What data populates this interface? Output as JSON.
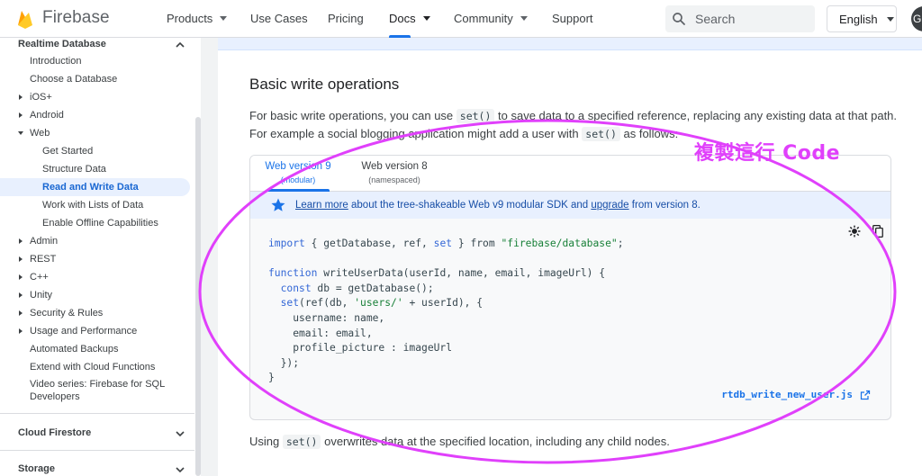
{
  "header": {
    "brand": "Firebase",
    "nav": [
      {
        "label": "Products",
        "dropdown": true
      },
      {
        "label": "Use Cases",
        "dropdown": false
      },
      {
        "label": "Pricing",
        "dropdown": false
      },
      {
        "label": "Docs",
        "dropdown": true,
        "active": true
      },
      {
        "label": "Community",
        "dropdown": true
      },
      {
        "label": "Support",
        "dropdown": false
      }
    ],
    "search_placeholder": "Search",
    "language": "English",
    "avatar_initial": "G"
  },
  "sidebar": {
    "section_title": "Realtime Database",
    "items": [
      {
        "label": "Introduction"
      },
      {
        "label": "Choose a Database"
      },
      {
        "label": "iOS+"
      },
      {
        "label": "Android"
      },
      {
        "label": "Web"
      },
      {
        "label": "Get Started"
      },
      {
        "label": "Structure Data"
      },
      {
        "label": "Read and Write Data"
      },
      {
        "label": "Work with Lists of Data"
      },
      {
        "label": "Enable Offline Capabilities"
      },
      {
        "label": "Admin"
      },
      {
        "label": "REST"
      },
      {
        "label": "C++"
      },
      {
        "label": "Unity"
      },
      {
        "label": "Security & Rules"
      },
      {
        "label": "Usage and Performance"
      },
      {
        "label": "Automated Backups"
      },
      {
        "label": "Extend with Cloud Functions"
      },
      {
        "label_line1": "Video series: Firebase for SQL",
        "label_line2": "Developers"
      }
    ],
    "section2_title": "Cloud Firestore",
    "section3_title": "Storage"
  },
  "main": {
    "heading": "Basic write operations",
    "para1_a": "For basic write operations, you can use ",
    "para1_code1": "set()",
    "para1_b": " to save data to a specified reference, replacing any existing data at that path. For example a social blogging application might add a user with ",
    "para1_code2": "set()",
    "para1_c": " as follows:",
    "tabs": [
      {
        "title": "Web version 9",
        "subtitle": "(modular)"
      },
      {
        "title": "Web version 8",
        "subtitle": "(namespaced)"
      }
    ],
    "notice_link1": "Learn more",
    "notice_mid": " about the tree-shakeable Web v9 modular SDK and ",
    "notice_link2": "upgrade",
    "notice_end": " from version 8.",
    "code": {
      "l1_kw": "import",
      "l1_a": " { getDatabase, ref, ",
      "l1_kw2": "set",
      "l1_b": " } from ",
      "l1_str": "\"firebase/database\"",
      "l1_c": ";",
      "l3_kw": "function",
      "l3_a": " writeUserData(userId, name, email, imageUrl) {",
      "l4_kw": "const",
      "l4_a": " db = getDatabase();",
      "l5_kw": "set",
      "l5_a": "(ref(db, ",
      "l5_str": "'users/'",
      "l5_b": " + userId), {",
      "l6": "    username: name,",
      "l7": "    email: email,",
      "l8": "    profile_picture : imageUrl",
      "l9": "  });",
      "l10": "}"
    },
    "file_link": "rtdb_write_new_user.js",
    "para2_a": "Using ",
    "para2_code": "set()",
    "para2_b": " overwrites data at the specified location, including any child nodes."
  },
  "annotation": {
    "text": "複製這行 Code",
    "color": "#e040fb"
  }
}
